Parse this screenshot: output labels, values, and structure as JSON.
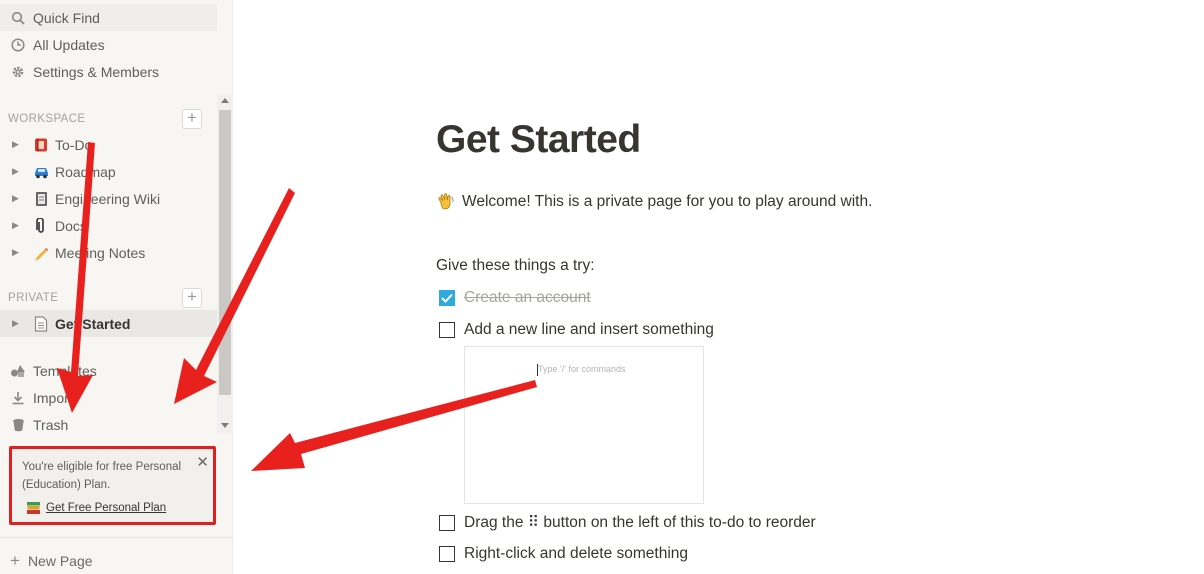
{
  "sidebar": {
    "top_items": [
      {
        "label": "Quick Find",
        "icon": "search-icon"
      },
      {
        "label": "All Updates",
        "icon": "clock-icon"
      },
      {
        "label": "Settings & Members",
        "icon": "gear-icon"
      }
    ],
    "workspace_label": "WORKSPACE",
    "workspace_pages": [
      {
        "label": "To-Do",
        "icon": "todo-book-icon"
      },
      {
        "label": "Roadmap",
        "icon": "car-icon"
      },
      {
        "label": "Engineering Wiki",
        "icon": "notebook-icon"
      },
      {
        "label": "Docs",
        "icon": "paperclip-icon"
      },
      {
        "label": "Meeting Notes",
        "icon": "pencil-icon"
      }
    ],
    "private_label": "PRIVATE",
    "private_pages": [
      {
        "label": "Get Started",
        "icon": "page-icon",
        "selected": true
      }
    ],
    "bottom_items": [
      {
        "label": "Templates",
        "icon": "shapes-icon"
      },
      {
        "label": "Import",
        "icon": "download-icon"
      },
      {
        "label": "Trash",
        "icon": "trash-icon"
      }
    ],
    "promo": {
      "text": "You're eligible for free Personal (Education) Plan.",
      "link": "Get Free Personal Plan",
      "border_color": "#e02020"
    },
    "new_page": "New Page"
  },
  "page": {
    "title": "Get Started",
    "welcome": "Welcome! This is a private page for you to play around with.",
    "welcome_icon": "waving-hand-icon",
    "try_heading": "Give these things a try:",
    "todos": [
      {
        "label": "Create an account",
        "checked": true
      },
      {
        "label": "Add a new line and insert something",
        "checked": false
      },
      {
        "label": "Drag the ⠿ button on the left of this to-do to reorder",
        "checked": false
      },
      {
        "label": "Right-click and delete something",
        "checked": false
      }
    ],
    "embed_placeholder": "Type '/' for commands"
  },
  "colors": {
    "sidebar_bg": "#f7f6f3",
    "accent_checkbox": "#2eaadc",
    "annotation_red": "#e8211f"
  }
}
